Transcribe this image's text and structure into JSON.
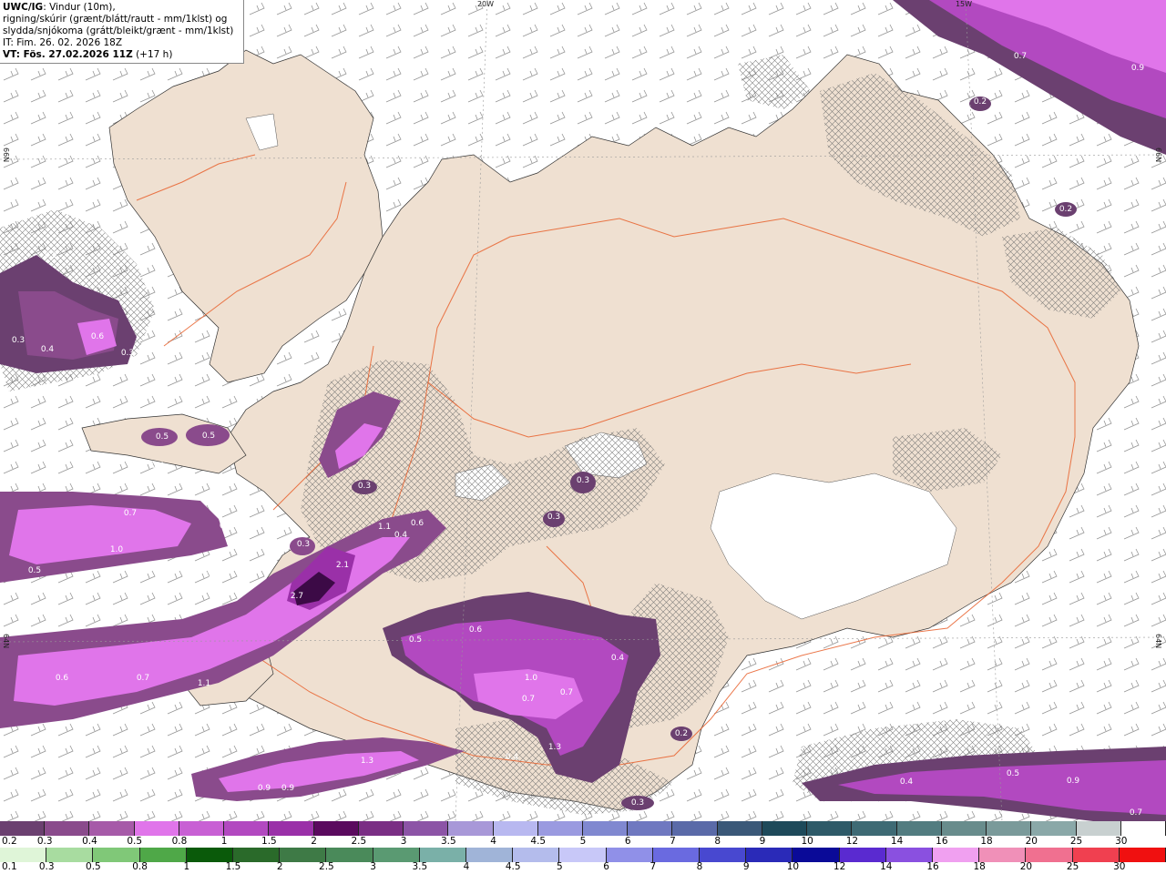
{
  "header": {
    "model": "UWC/IG",
    "desc_line1": ": Vindur (10m),",
    "desc_line2": "rigning/skúrir (grænt/blátt/rautt - mm/1klst) og",
    "desc_line3": "slydda/snjókoma (grátt/bleikt/grænt - mm/1klst)",
    "init_time": "IT: Fim. 26. 02. 2026 18Z",
    "valid_label": "VT: Fös. 27.02.2026 11Z",
    "lead": " (+17 h)"
  },
  "graticule": {
    "lon_labels": [
      "20W",
      "15W"
    ],
    "lat_labels": [
      "66N",
      "64N"
    ]
  },
  "colors": {
    "land": "#f0e0d0",
    "sea": "#ffffff",
    "roads": "#e8602c",
    "precip_light": "#dc78e6",
    "precip_mid": "#b040c0",
    "precip_dark": "#6a2a70",
    "precip_max": "#3c0a46"
  },
  "map_values": [
    "0.2",
    "0.3",
    "0.4",
    "0.6",
    "0.3",
    "0.5",
    "0.5",
    "0.4",
    "0.6",
    "0.3",
    "0.7",
    "1.0",
    "0.5",
    "0.4",
    "0.3",
    "1.1",
    "0.6",
    "0.4",
    "2.1",
    "2.7",
    "0.3",
    "0.5",
    "0.6",
    "0.4",
    "1.0",
    "0.7",
    "0.7",
    "1.3",
    "0.6",
    "0.7",
    "1.1",
    "0.9",
    "0.4",
    "1.3",
    "0.9",
    "0.9",
    "0.3",
    "0.4",
    "0.2",
    "0.5",
    "0.9",
    "0.7",
    "0.2",
    "0.9",
    "0.7",
    "0.2",
    "0.3",
    "0.3"
  ],
  "legend_snow": {
    "labels": [
      "0.2",
      "0.3",
      "0.4",
      "0.5",
      "0.8",
      "1",
      "1.5",
      "2",
      "2.5",
      "3",
      "3.5",
      "4",
      "4.5",
      "5",
      "6",
      "7",
      "8",
      "9",
      "10",
      "12",
      "14",
      "16",
      "18",
      "20",
      "25",
      "30"
    ],
    "colors": [
      "#6b4070",
      "#8a4b8c",
      "#a65aa8",
      "#e075ea",
      "#c860d4",
      "#b249c0",
      "#9a30a8",
      "#5a0a5e",
      "#7a2e84",
      "#8c54a6",
      "#a898d8",
      "#b8b8f0",
      "#9a9ae0",
      "#8088d0",
      "#6f78c0",
      "#5a6aa8",
      "#3a5878",
      "#1e4a5a",
      "#2e5a68",
      "#3e6a74",
      "#527c80",
      "#688c8c",
      "#7a9a9a",
      "#8aa8a8",
      "#c8d0d0",
      "#ffffff"
    ]
  },
  "legend_rain": {
    "labels": [
      "0.1",
      "0.3",
      "0.5",
      "0.8",
      "1",
      "1.5",
      "2",
      "2.5",
      "3",
      "3.5",
      "4",
      "4.5",
      "5",
      "6",
      "7",
      "8",
      "9",
      "10",
      "12",
      "14",
      "16",
      "18",
      "20",
      "25",
      "30"
    ],
    "colors": [
      "#dff5d8",
      "#a8dca0",
      "#80c878",
      "#4fa848",
      "#0a5a0a",
      "#2a6a2a",
      "#3e7a46",
      "#4a8a5a",
      "#5a9a72",
      "#7ab0a8",
      "#a0b4d8",
      "#b4bcec",
      "#c8c8f8",
      "#9090e8",
      "#6a6ae0",
      "#4848d0",
      "#2a2ab8",
      "#0a0a98",
      "#5a2ad0",
      "#8a50e0",
      "#f0a0f0",
      "#f090b8",
      "#f07090",
      "#f04050",
      "#f01010"
    ]
  }
}
